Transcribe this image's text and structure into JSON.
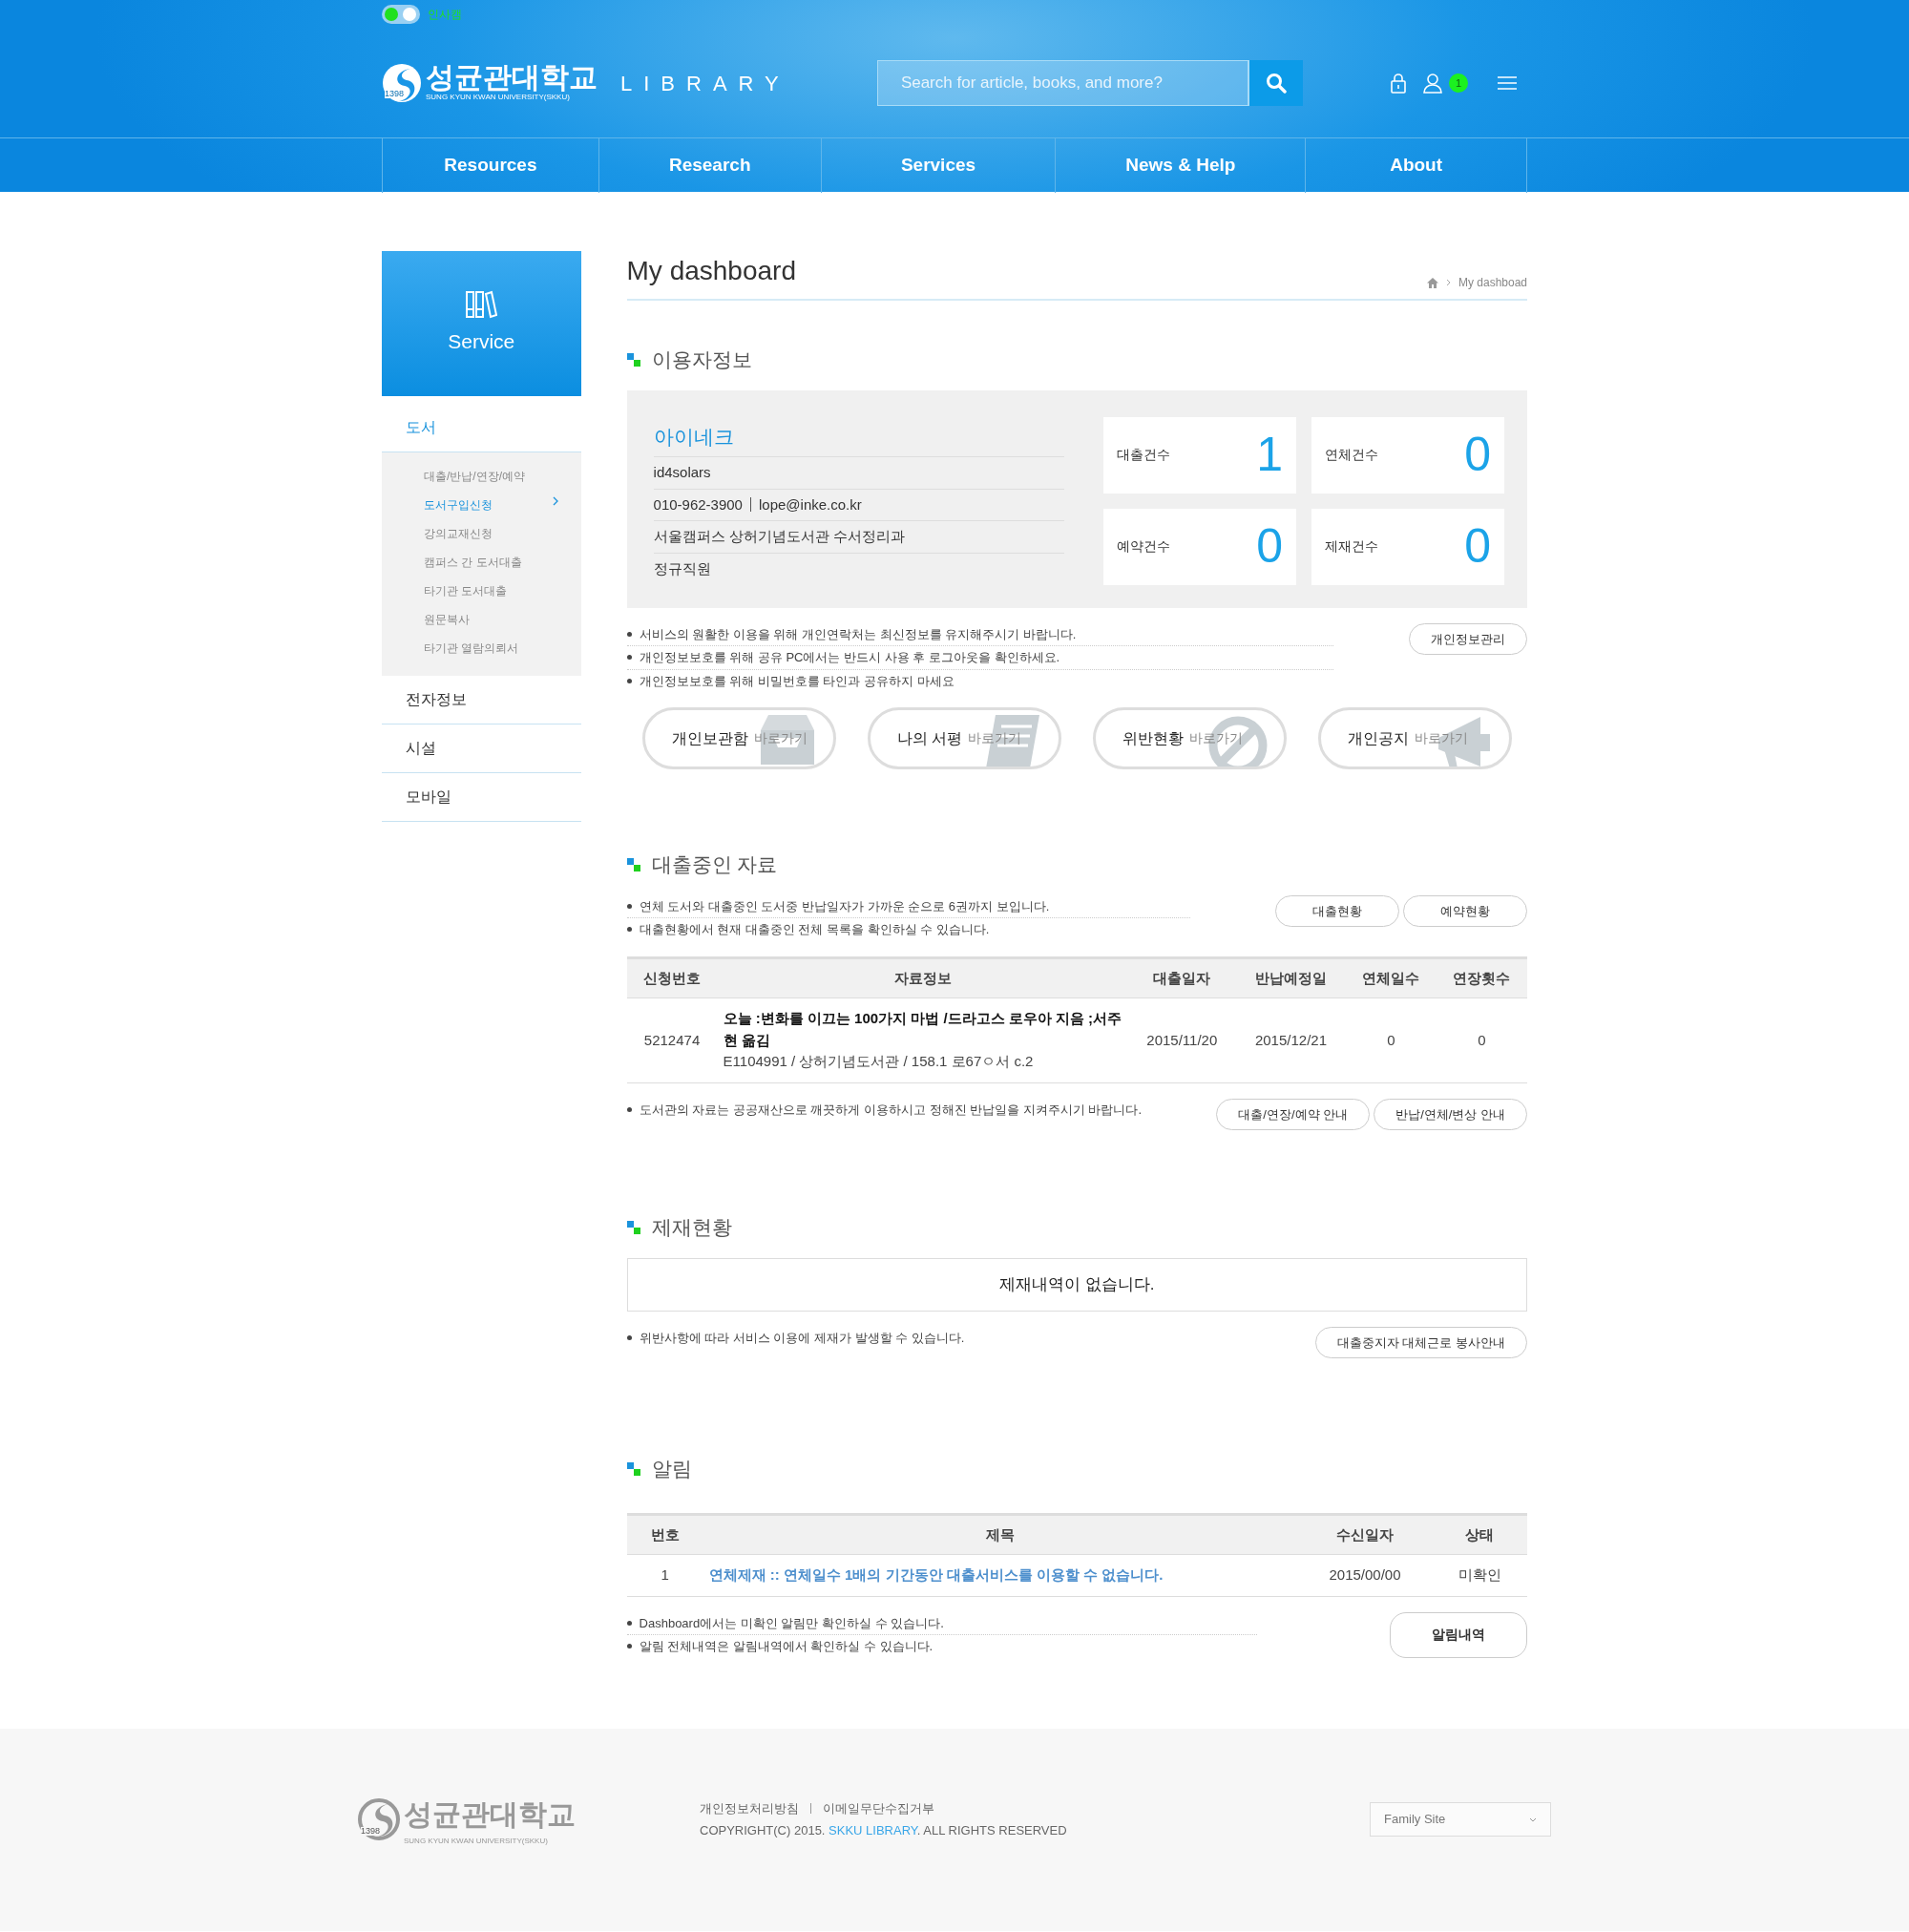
{
  "campus_toggle": {
    "label": "인사캠",
    "on": true
  },
  "logo": {
    "name": "성균관대학교",
    "subtitle": "SUNG KYUN KWAN UNIVERSITY(SKKU)",
    "year": "1398",
    "library": "LIBRARY"
  },
  "search": {
    "placeholder": "Search for article, books, and more?"
  },
  "notification_count": "1",
  "nav": [
    "Resources",
    "Research",
    "Services",
    "News & Help",
    "About"
  ],
  "sidebar": {
    "title": "Service",
    "groups": [
      {
        "label": "도서",
        "selected": true,
        "children": [
          {
            "label": "대출/반납/연장/예약",
            "selected": false
          },
          {
            "label": "도서구입신청",
            "selected": true
          },
          {
            "label": "강의교재신청",
            "selected": false
          },
          {
            "label": "캠퍼스 간 도서대출",
            "selected": false
          },
          {
            "label": "타기관 도서대출",
            "selected": false
          },
          {
            "label": "원문복사",
            "selected": false
          },
          {
            "label": "타기관 열람의뢰서",
            "selected": false
          }
        ]
      },
      {
        "label": "전자정보",
        "selected": false
      },
      {
        "label": "시설",
        "selected": false
      },
      {
        "label": "모바일",
        "selected": false
      }
    ]
  },
  "page": {
    "title": "My dashboard",
    "breadcrumb": "My dashboad"
  },
  "user_info": {
    "heading": "이용자정보",
    "name": "아이네크",
    "id": "id4solars",
    "phone": "010-962-3900",
    "email": "lope@inke.co.kr",
    "department": "서울캠퍼스 상허기념도서관 수서정리과",
    "position": "정규직원",
    "stats": [
      {
        "label": "대출건수",
        "value": "1"
      },
      {
        "label": "연체건수",
        "value": "0"
      },
      {
        "label": "예약건수",
        "value": "0"
      },
      {
        "label": "제재건수",
        "value": "0"
      }
    ],
    "notes": [
      "서비스의 원활한 이용을 위해 개인연락처는 최신정보를 유지해주시기 바랍니다.",
      "개인정보보호를 위해 공유 PC에서는 반드시 사용 후 로그아웃을 확인하세요.",
      "개인정보보호를 위해 비밀번호를 타인과 공유하지 마세요"
    ],
    "button": "개인정보관리",
    "shortcuts": [
      {
        "title": "개인보관함",
        "link": "바로가기",
        "kind": "tray"
      },
      {
        "title": "나의 서평",
        "link": "바로가기",
        "kind": "book"
      },
      {
        "title": "위반현황",
        "link": "바로가기",
        "kind": "ban"
      },
      {
        "title": "개인공지",
        "link": "바로가기",
        "kind": "megaphone"
      }
    ]
  },
  "loans": {
    "heading": "대출중인 자료",
    "notes": [
      "연체 도서와 대출중인 도서중 반납일자가 가까운 순으로 6권까지 보입니다.",
      "대출현황에서 현재 대출중인 전체 목록을 확인하실 수 있습니다."
    ],
    "buttons": [
      "대출현황",
      "예약현황"
    ],
    "columns": [
      "신청번호",
      "자료정보",
      "대출일자",
      "반납예정일",
      "연체일수",
      "연장횟수"
    ],
    "rows": [
      {
        "number": "5212474",
        "title": "오늘 :변화를 이끄는 100가지 마법 /드라고스 로우아 지음 ;서주현 옮김",
        "detail": "E1104991 /  상허기념도서관 / 158.1 로67ㅇ서 c.2",
        "loan_date": "2015/11/20",
        "due_date": "2015/12/21",
        "overdue_days": "0",
        "renewals": "0"
      }
    ],
    "footer_note": "도서관의 자료는 공공재산으로 깨끗하게 이용하시고 정해진 반납일을 지켜주시기 바랍니다.",
    "footer_buttons": [
      "대출/연장/예약 안내",
      "반납/연체/변상 안내"
    ]
  },
  "sanctions": {
    "heading": "제재현황",
    "empty": "제재내역이 없습니다.",
    "note": "위반사항에 따라 서비스 이용에 제재가 발생할 수 있습니다.",
    "button": "대출중지자 대체근로 봉사안내"
  },
  "alerts": {
    "heading": "알림",
    "columns": [
      "번호",
      "제목",
      "수신일자",
      "상태"
    ],
    "rows": [
      {
        "number": "1",
        "title": "연체제재 :: 연체일수 1배의 기간동안 대출서비스를 이용할 수 없습니다.",
        "date": "2015/00/00",
        "status": "미확인"
      }
    ],
    "notes": [
      "Dashboard에서는 미확인 알림만 확인하실 수 있습니다.",
      "알림 전체내역은 알림내역에서 확인하실 수 있습니다."
    ],
    "button": "알림내역"
  },
  "footer": {
    "logo_name": "성균관대학교",
    "logo_subtitle": "SUNG KYUN KWAN UNIVERSITY(SKKU)",
    "logo_year": "1398",
    "links": [
      "개인정보처리방침",
      "이메일무단수집거부"
    ],
    "copyright_before": "COPYRIGHT(C) 2015.",
    "copyright_link": "SKKU LIBRARY",
    "copyright_after": ".  ALL RIGHTS RESERVED",
    "family_site": "Family Site"
  }
}
